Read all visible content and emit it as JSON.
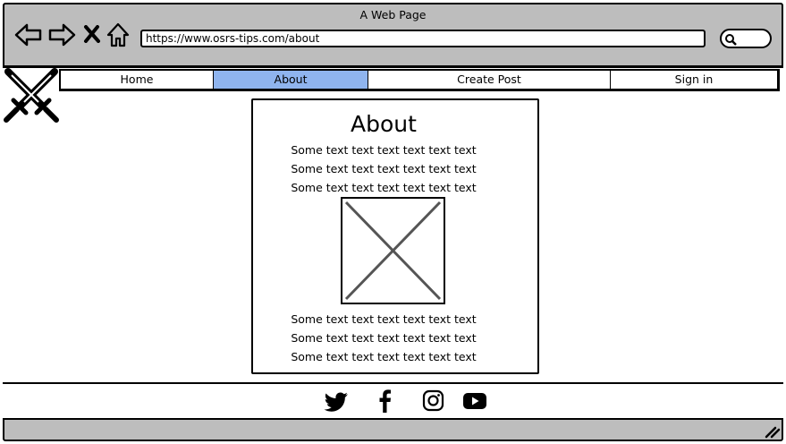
{
  "browser": {
    "window_title": "A Web Page",
    "url": "https://www.osrs-tips.com/about",
    "nav_icons": [
      "back-arrow-icon",
      "forward-arrow-icon",
      "close-icon",
      "home-icon"
    ],
    "search_icon": "magnifier-icon"
  },
  "site": {
    "logo_icon": "crossed-swords-icon",
    "nav": [
      {
        "label": "Home",
        "active": false
      },
      {
        "label": "About",
        "active": true
      },
      {
        "label": "Create Post",
        "active": false
      },
      {
        "label": "Sign in",
        "active": false
      }
    ],
    "active_color": "#8fb4ee"
  },
  "page": {
    "heading": "About",
    "paragraphs_top": [
      "Some text text text text text text",
      "Some text text text text text text",
      "Some text text text text text text"
    ],
    "image_placeholder_icon": "image-placeholder-icon",
    "paragraphs_bottom": [
      "Some text text text text text text",
      "Some text text text text text text",
      "Some text text text text text text"
    ]
  },
  "footer": {
    "social_icons": [
      "twitter-icon",
      "facebook-icon",
      "instagram-icon",
      "youtube-icon"
    ]
  }
}
